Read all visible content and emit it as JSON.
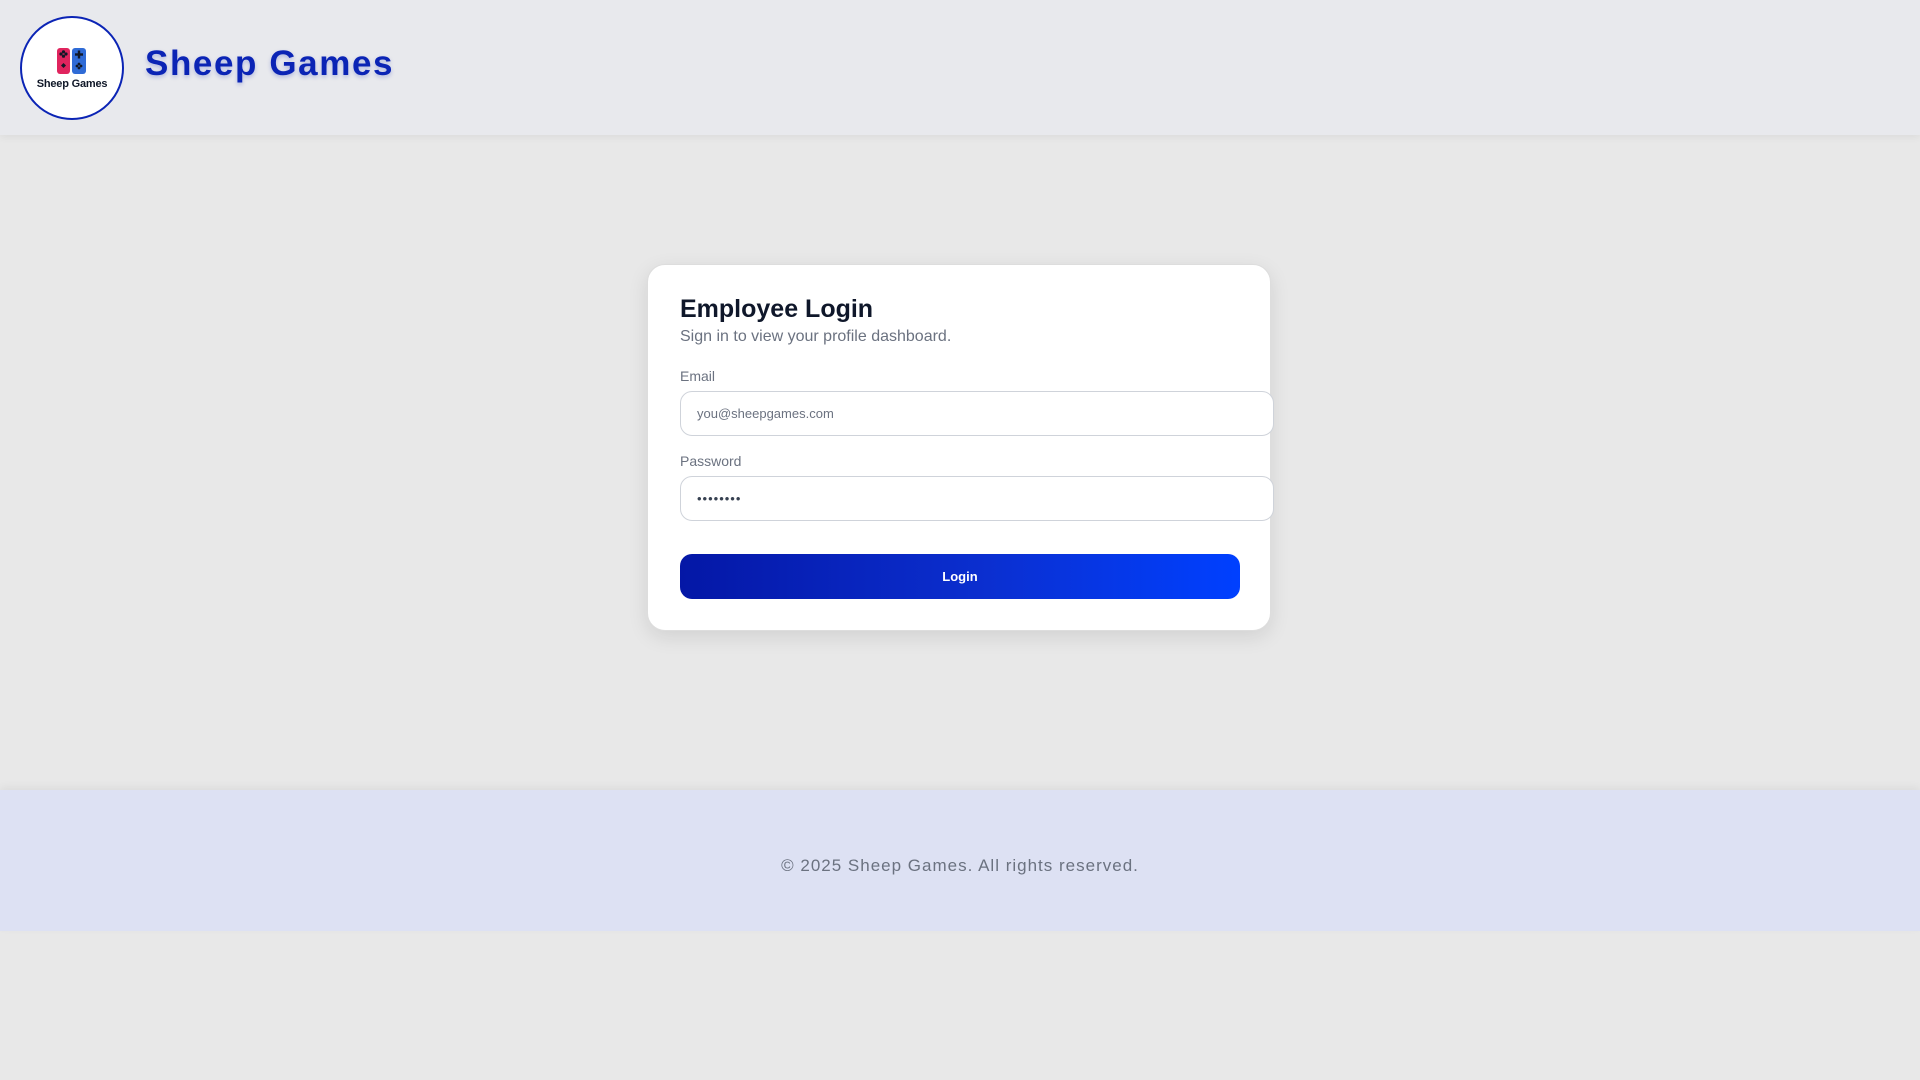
{
  "header": {
    "logo_text": "Sheep Games",
    "brand_title": "Sheep Games"
  },
  "login": {
    "title": "Employee Login",
    "subtitle": "Sign in to view your profile dashboard.",
    "email_label": "Email",
    "email_placeholder": "you@sheepgames.com",
    "email_value": "",
    "password_label": "Password",
    "password_value": "••••••••",
    "login_button": "Login"
  },
  "footer": {
    "copyright": "© 2025 Sheep Games. All rights reserved."
  },
  "colors": {
    "brand_blue": "#0b24b5",
    "button_gradient_start": "#0417a6",
    "button_gradient_end": "#0040ff",
    "footer_bg": "#dde1f3"
  },
  "icons": {
    "logo": "game-controller-icon"
  }
}
